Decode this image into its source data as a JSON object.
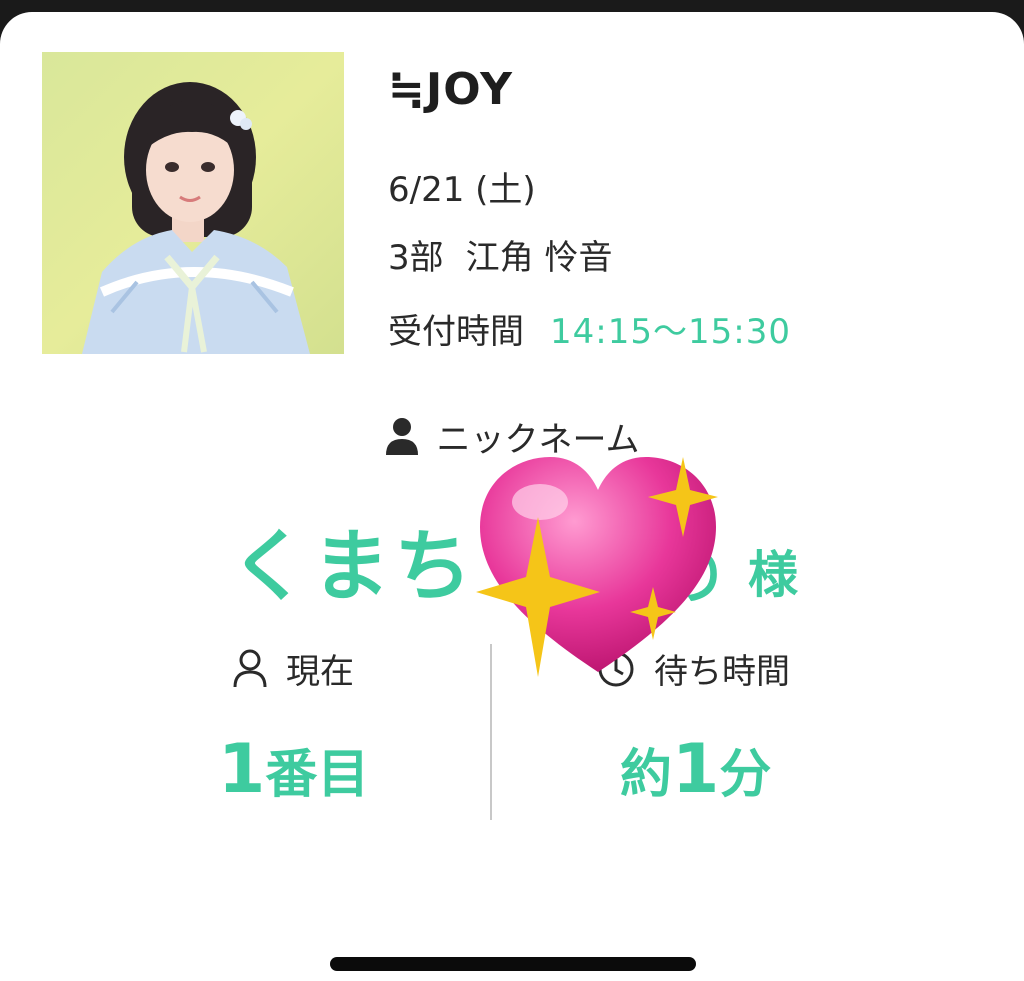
{
  "event": {
    "group_name": "≒JOY",
    "date": "6/21 (土)",
    "slot": "3部",
    "member_name": "江角 怜音",
    "reception_label": "受付時間",
    "reception_time": "14:15〜15:30"
  },
  "nickname": {
    "label": "ニックネーム",
    "value": "くまち",
    "value_fragment": "り",
    "honorific": "様"
  },
  "status": {
    "position_label": "現在",
    "position_number": "1",
    "position_unit": "番目",
    "wait_label": "待ち時間",
    "wait_prefix": "約",
    "wait_number": "1",
    "wait_unit": "分"
  },
  "colors": {
    "accent": "#3ecb9f",
    "heart": "#e8379a",
    "sparkle": "#f5c518"
  },
  "icons": {
    "nickname": "person-filled-icon",
    "position": "person-outline-icon",
    "wait": "clock-icon",
    "overlay": "sparkling-heart-emoji"
  }
}
